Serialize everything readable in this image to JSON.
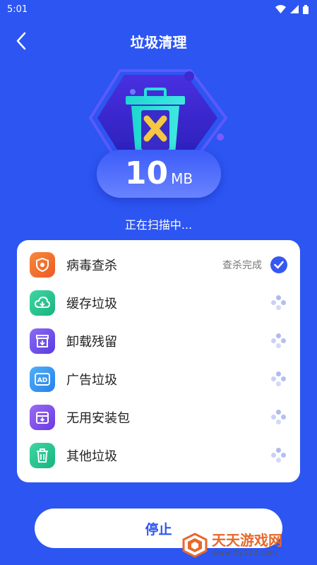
{
  "status_bar": {
    "time": "5:01"
  },
  "header": {
    "title": "垃圾清理"
  },
  "scan": {
    "size_value": "10",
    "size_unit": "MB",
    "status_text": "正在扫描中..."
  },
  "items": [
    {
      "label": "病毒查杀",
      "status": "查杀完成",
      "state": "done",
      "icon": "shield-virus-icon",
      "color": "#f0672b"
    },
    {
      "label": "缓存垃圾",
      "status": "",
      "state": "loading",
      "icon": "cloud-icon",
      "color": "#1fbf8a"
    },
    {
      "label": "卸载残留",
      "status": "",
      "state": "loading",
      "icon": "uninstall-box-icon",
      "color": "#6d4ae8"
    },
    {
      "label": "广告垃圾",
      "status": "",
      "state": "loading",
      "icon": "ad-icon",
      "color": "#2c8ff0"
    },
    {
      "label": "无用安装包",
      "status": "",
      "state": "loading",
      "icon": "package-icon",
      "color": "#7a4ae8"
    },
    {
      "label": "其他垃圾",
      "status": "",
      "state": "loading",
      "icon": "trash-icon",
      "color": "#1fbf8a"
    }
  ],
  "stop_button": {
    "label": "停止"
  },
  "watermark": {
    "title": "天天游戏网",
    "url": "www.tty123.com"
  },
  "colors": {
    "background": "#2c55f2",
    "accent": "#3657f0",
    "card": "#ffffff"
  }
}
